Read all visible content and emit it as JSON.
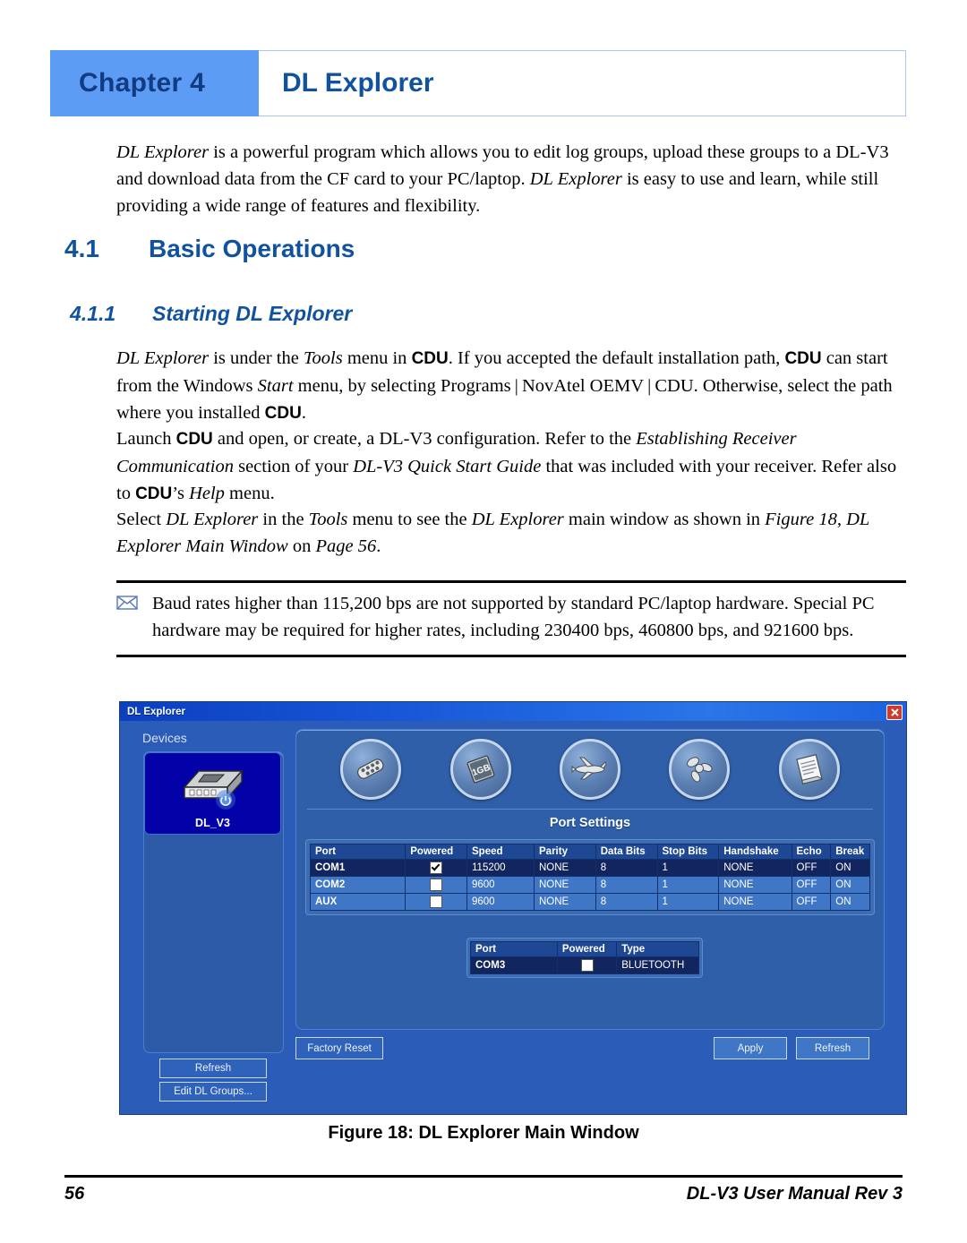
{
  "chapter": {
    "label": "Chapter  4",
    "title": "DL Explorer"
  },
  "intro_paragraph": "DL Explorer is a powerful program which allows you to edit log groups, upload these groups to a DL-V3 and download data from the CF card to your PC/laptop. DL Explorer is easy to use and learn, while still providing a wide range of features and flexibility.",
  "section": {
    "number": "4.1",
    "title": "Basic Operations"
  },
  "subsection": {
    "number": "4.1.1",
    "title": "Starting DL Explorer"
  },
  "paragraphs": {
    "p1": "DL Explorer is under the Tools menu in CDU. If you accepted the default installation path, CDU can start from the Windows Start menu, by selecting Programs | NovAtel OEMV | CDU. Otherwise, select the path where you installed CDU.",
    "p2": "Launch CDU and open, or create, a DL-V3 configuration. Refer to the Establishing Receiver Communication section of your DL-V3 Quick Start Guide that was included with your receiver. Refer also to CDU's Help menu.",
    "p3": "Select DL Explorer in the Tools menu to see the DL Explorer main window as shown in Figure 18, DL Explorer Main Window on Page 56."
  },
  "note": {
    "icon": "envelope-icon",
    "text": "Baud rates higher than 115,200 bps are not supported by standard PC/laptop hardware. Special PC hardware may be required for higher rates, including 230400 bps, 460800 bps, and 921600 bps."
  },
  "app": {
    "title": "DL Explorer",
    "close_label": "✖",
    "devices_label": "Devices",
    "device": {
      "name": "DL_V3",
      "icon": "dl-v3-receiver-icon"
    },
    "left_buttons": [
      {
        "label": "Refresh",
        "name": "refresh-devices-button"
      },
      {
        "label": "Edit DL Groups...",
        "name": "edit-dl-groups-button"
      }
    ],
    "toolbar_icons": [
      {
        "name": "ports-connector-icon",
        "label": "Ports"
      },
      {
        "name": "memory-card-1gb-icon",
        "label": "1GB"
      },
      {
        "name": "airplane-icon",
        "label": "Airborne"
      },
      {
        "name": "antenna-icon",
        "label": "Antenna"
      },
      {
        "name": "log-notepad-icon",
        "label": "Logs"
      }
    ],
    "port_settings_title": "Port Settings",
    "port_table": {
      "columns": [
        "Port",
        "Powered",
        "Speed",
        "Parity",
        "Data Bits",
        "Stop Bits",
        "Handshake",
        "Echo",
        "Break"
      ],
      "rows": [
        {
          "port": "COM1",
          "powered": true,
          "speed": "115200",
          "parity": "NONE",
          "data_bits": "8",
          "stop_bits": "1",
          "handshake": "NONE",
          "echo": "OFF",
          "break": "ON",
          "selected": true
        },
        {
          "port": "COM2",
          "powered": false,
          "speed": "9600",
          "parity": "NONE",
          "data_bits": "8",
          "stop_bits": "1",
          "handshake": "NONE",
          "echo": "OFF",
          "break": "ON",
          "selected": false
        },
        {
          "port": "AUX",
          "powered": false,
          "speed": "9600",
          "parity": "NONE",
          "data_bits": "8",
          "stop_bits": "1",
          "handshake": "NONE",
          "echo": "OFF",
          "break": "ON",
          "selected": false
        }
      ]
    },
    "type_table": {
      "columns": [
        "Port",
        "Powered",
        "Type"
      ],
      "rows": [
        {
          "port": "COM3",
          "powered": false,
          "type": "BLUETOOTH",
          "selected": true
        }
      ]
    },
    "bottom_buttons": [
      {
        "label": "Factory Reset",
        "name": "factory-reset-button"
      },
      {
        "label": "Apply",
        "name": "apply-button"
      },
      {
        "label": "Refresh",
        "name": "refresh-ports-button"
      }
    ],
    "colors": {
      "titlebar": "#1757d8",
      "window_bg": "#2a5cb8",
      "panel_bg": "#2f5fa8",
      "selected_row": "#12255e",
      "normal_row": "#3f77c6",
      "device_selected": "#0202a8",
      "close_button": "#d23a2c"
    }
  },
  "figure_caption": "Figure 18: DL Explorer Main Window",
  "footer": {
    "page_number": "56",
    "manual": "DL-V3 User Manual Rev 3"
  },
  "theme": {
    "heading_blue": "#11529f",
    "chapter_tab_blue": "#5d9cf5",
    "chapter_tab_text": "#123c82"
  }
}
